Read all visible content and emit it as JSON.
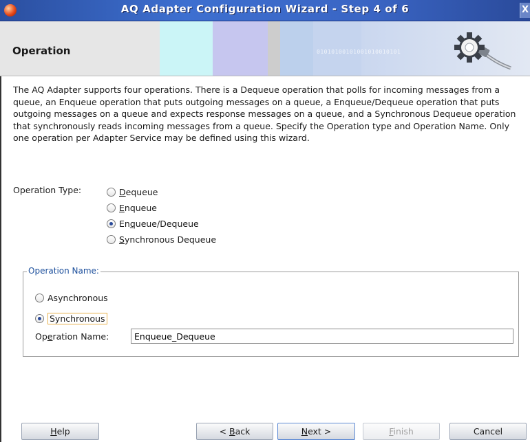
{
  "window": {
    "title": "AQ Adapter Configuration Wizard - Step 4 of 6",
    "close_glyph": "X"
  },
  "header": {
    "page_title": "Operation",
    "binary_text": "01010100101001010010101"
  },
  "intro_text": "The AQ Adapter supports four operations.  There is a Dequeue operation that polls for incoming messages from a queue, an Enqueue operation that puts outgoing messages on a queue, a Enqueue/Dequeue operation that puts outgoing messages on a queue and expects response messages on a queue, and a Synchronous Dequeue operation that synchronously reads incoming messages from a queue.  Specify the Operation type and Operation Name. Only one operation per Adapter Service may be defined using this wizard.",
  "operation_type": {
    "label": "Operation Type:",
    "options": [
      {
        "m": "D",
        "rest": "equeue",
        "selected": false
      },
      {
        "m": "E",
        "rest": "nqueue",
        "selected": false
      },
      {
        "pre": "En",
        "m": "q",
        "rest": "ueue/Dequeue",
        "selected": true
      },
      {
        "m": "S",
        "rest": "ynchronous Dequeue",
        "selected": false
      }
    ]
  },
  "operation_group": {
    "legend": "Operation Name:",
    "asynchronous": "Asynchronous",
    "synchronous": "Synchronous",
    "selected": "Synchronous",
    "name_label_pre": "Op",
    "name_label_m": "e",
    "name_label_rest": "ration Name:",
    "name_value": "Enqueue_Dequeue"
  },
  "buttons": {
    "help": {
      "m": "H",
      "rest": "elp"
    },
    "back": {
      "pre": "< ",
      "m": "B",
      "rest": "ack"
    },
    "next": {
      "m": "N",
      "rest": "ext >"
    },
    "finish": {
      "m": "F",
      "rest": "inish"
    },
    "cancel": "Cancel"
  },
  "colors": {
    "title_bar": "#3a65c4",
    "legend_text": "#1c4f9c",
    "focus_border": "#e8b04a",
    "default_button_border": "#5a88d4"
  },
  "icons": {
    "app": "oracle-logo-icon",
    "header_graphic": "gear-plug-icon"
  }
}
